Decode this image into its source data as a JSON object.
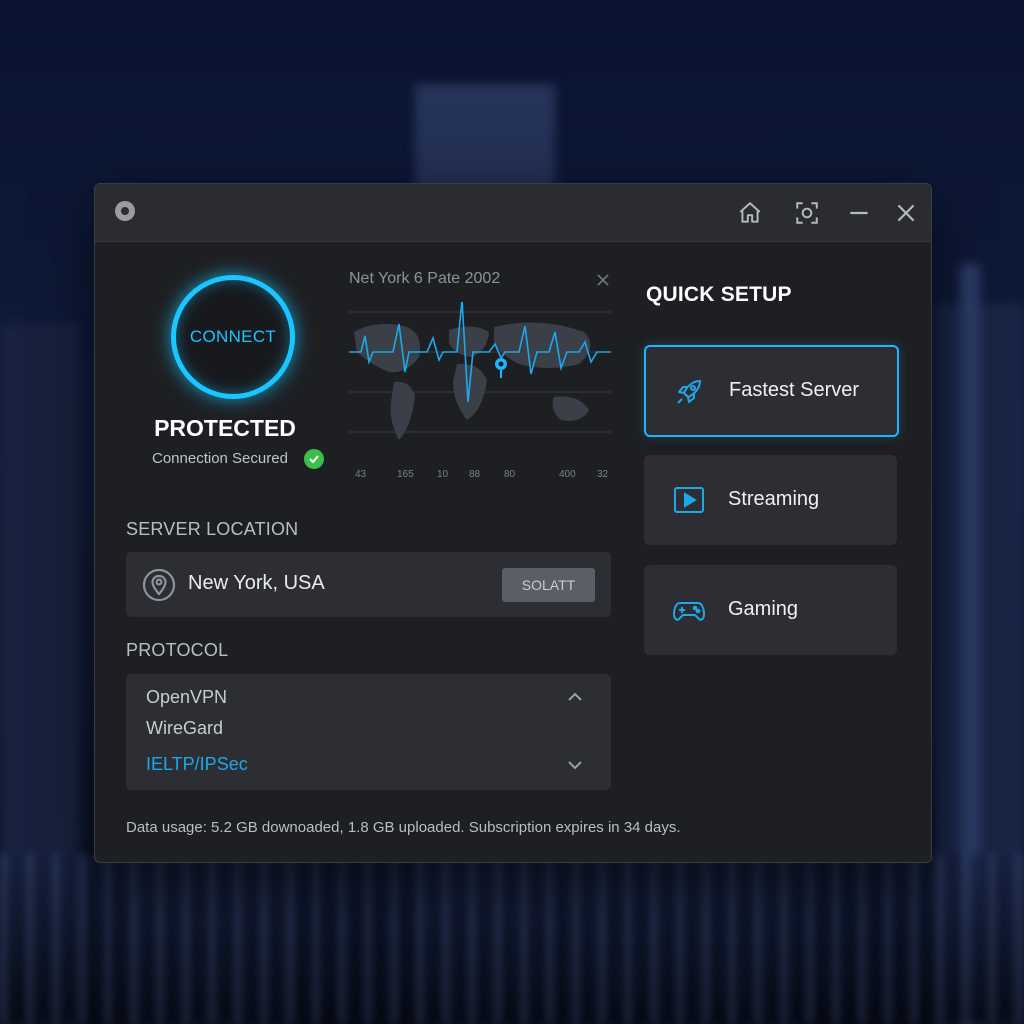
{
  "status": {
    "connect_label": "CONNECT",
    "title": "PROTECTED",
    "subtitle": "Connection Secured"
  },
  "map": {
    "title": "Net York 6 Pate 2002",
    "x_ticks": [
      "43",
      "165",
      "10",
      "88",
      "80",
      "400",
      "32"
    ]
  },
  "server": {
    "section_label": "SERVER LOCATION",
    "location": "New York, USA",
    "select_label": "SOLATT"
  },
  "protocol": {
    "section_label": "PROTOCOL",
    "options": [
      "OpenVPN",
      "WireGard",
      "IELTP/IPSec"
    ],
    "selected_index": 2
  },
  "footer": {
    "text": "Data usage: 5.2 GB downoaded, 1.8 GB uploaded. Subscription expires in 34 days."
  },
  "quick_setup": {
    "title": "QUICK SETUP",
    "items": [
      {
        "label": "Fastest Server",
        "icon": "rocket-icon",
        "active": true
      },
      {
        "label": "Streaming",
        "icon": "play-icon",
        "active": false
      },
      {
        "label": "Gaming",
        "icon": "gamepad-icon",
        "active": false
      }
    ]
  },
  "colors": {
    "accent": "#19c6ff",
    "success": "#3cbf4a",
    "panel": "#2c2e33",
    "window": "#1e1f22"
  }
}
